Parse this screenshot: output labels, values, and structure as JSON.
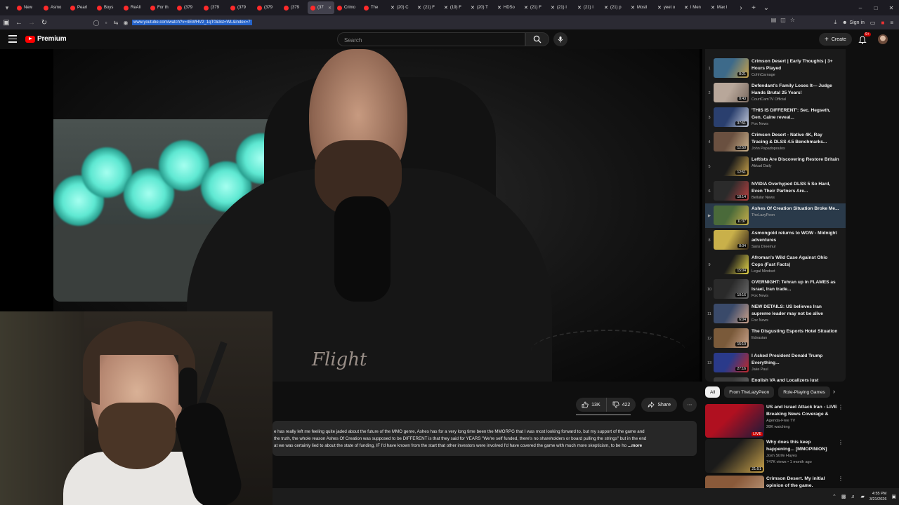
{
  "browser": {
    "tabs": [
      {
        "label": "New",
        "fav": "red"
      },
      {
        "label": "Asmo",
        "fav": "red"
      },
      {
        "label": "Pearl",
        "fav": "red"
      },
      {
        "label": "Boys",
        "fav": "red"
      },
      {
        "label": "ReAll",
        "fav": "red"
      },
      {
        "label": "For th",
        "fav": "red"
      },
      {
        "label": "(379",
        "fav": "red"
      },
      {
        "label": "(379",
        "fav": "red"
      },
      {
        "label": "(379",
        "fav": "red"
      },
      {
        "label": "(379",
        "fav": "red"
      },
      {
        "label": "(379",
        "fav": "red"
      },
      {
        "label": "(37",
        "fav": "red",
        "active": true
      },
      {
        "label": "Crimo",
        "fav": "red"
      },
      {
        "label": "The",
        "fav": "red"
      },
      {
        "label": "(20) C",
        "fav": "x"
      },
      {
        "label": "(21) F",
        "fav": "x"
      },
      {
        "label": "(19) F",
        "fav": "x"
      },
      {
        "label": "(20) T",
        "fav": "x"
      },
      {
        "label": "HDSo",
        "fav": "x"
      },
      {
        "label": "(21) F",
        "fav": "x"
      },
      {
        "label": "(21) I",
        "fav": "x"
      },
      {
        "label": "(21) I",
        "fav": "x"
      },
      {
        "label": "(21) p",
        "fav": "x"
      },
      {
        "label": "Mostl",
        "fav": "x"
      },
      {
        "label": "yeet o",
        "fav": "x"
      },
      {
        "label": "I Men",
        "fav": "x"
      },
      {
        "label": "Max I",
        "fav": "x"
      }
    ],
    "url": "www.youtube.com/watch?v=4EWHV2_1qT0&list=WL&index=7",
    "signin_label": "Sign in"
  },
  "masthead": {
    "brand": "Premium",
    "search_placeholder": "Search",
    "create_label": "Create",
    "notif_badge": "9+"
  },
  "video": {
    "overlay_text": "Flight",
    "likes": "13K",
    "dislikes": "422",
    "share_label": "Share",
    "description": [
      "e has really left me feeling quite jaded about the future of the MMO genre, Ashes has for a very long time been the MMORPG that I was most looking forward to, but my support of the game and",
      " the truth, the whole reason Ashes Of Creation was supposed to be DIFFERENT is that they said for YEARS \"We're self funded, there's no shareholders or board pulling the strings\" but in the end",
      "at we was certainly lied to about the state of funding, IF I'd have known from the start that other investors were involved I'd have covered the game with much more skepticism, to be ho"
    ],
    "description_more": "...more"
  },
  "playlist": [
    {
      "idx": "1",
      "title": "Crimson Desert | Early Thoughts | 3+ Hours Played",
      "channel": "CohhCarnage",
      "duration": "8:21",
      "c1": "#3d6a8a",
      "c2": "#c9a24a"
    },
    {
      "idx": "2",
      "title": "Defendant's Family Loses It— Judge Hands Brutal 25 Years!",
      "channel": "CourtCamTV Official",
      "duration": "8:43",
      "c1": "#b8a79a",
      "c2": "#7a6a60"
    },
    {
      "idx": "3",
      "title": "'THIS IS DIFFERENT': Sec. Hegseth, Gen. Caine reveal...",
      "channel": "Fox News",
      "duration": "37:51",
      "c1": "#2a3f6e",
      "c2": "#c2c8d8"
    },
    {
      "idx": "4",
      "title": "Crimson Desert - Native 4K, Ray Tracing & DLSS 4.5 Benchmarks...",
      "channel": "John Papadopoulos",
      "duration": "12:50",
      "c1": "#6a5040",
      "c2": "#c9b08a"
    },
    {
      "idx": "5",
      "title": "Leftists Are Discovering Restore Britain",
      "channel": "Akkad Daily",
      "duration": "12:51",
      "c1": "#1a1a1a",
      "c2": "#c9a24a"
    },
    {
      "idx": "6",
      "title": "NVIDIA Overhyped DLSS 5 So Hard, Even Their Partners Are...",
      "channel": "Bellular News",
      "duration": "18:14",
      "c1": "#2b2b2b",
      "c2": "#b84040"
    },
    {
      "idx": "▶",
      "title": "Ashes Of Creation Situation Broke Me...",
      "channel": "TheLazyPeon",
      "duration": "11:37",
      "c1": "#4a6a3a",
      "c2": "#c9b04a",
      "current": true
    },
    {
      "idx": "8",
      "title": "Asmongold returns to WOW - Midnight adventures",
      "channel": "Sans Dreemur",
      "duration": "8:04",
      "c1": "#c9b04a",
      "c2": "#3a2a1a"
    },
    {
      "idx": "9",
      "title": "Afroman's Wild Case Against Ohio Cops (Fast Facts)",
      "channel": "Legal Mindset",
      "duration": "15:04",
      "c1": "#1a1a1a",
      "c2": "#e8d84a"
    },
    {
      "idx": "10",
      "title": "OVERNIGHT: Tehran up in FLAMES as Israel, Iran trade...",
      "channel": "Fox News",
      "duration": "10:16",
      "c1": "#2a2a2a",
      "c2": "#6a6a6a"
    },
    {
      "idx": "11",
      "title": "NEW DETAILS: US believes Iran supreme leader may not be alive",
      "channel": "Fox News",
      "duration": "6:04",
      "c1": "#3a4a6a",
      "c2": "#c9a08a"
    },
    {
      "idx": "12",
      "title": "The Disgusting Esports Hotel Situation",
      "channel": "Edvasian",
      "duration": "15:10",
      "c1": "#7a5a3a",
      "c2": "#c9a28a"
    },
    {
      "idx": "13",
      "title": "I Asked President Donald Trump Everything...",
      "channel": "Jake Paul",
      "duration": "27:16",
      "c1": "#2a3a8a",
      "c2": "#c0282a"
    },
    {
      "idx": "14",
      "title": "English VA and Localizers just",
      "channel": "",
      "duration": "",
      "c1": "#3a3a3a",
      "c2": "#6a6a6a"
    }
  ],
  "chips": [
    "All",
    "From TheLazyPeon",
    "Role-Playing Games"
  ],
  "recommendations": [
    {
      "title": "US and Israel Attack Iran - LIVE Breaking News Coverage & Wa...",
      "channel": "Agenda-Free TV",
      "stats": "28K watching",
      "duration": "LIVE",
      "c1": "#b01020",
      "c2": "#1a1a3a"
    },
    {
      "title": "Why does this keep happening... [MMOPINION]",
      "channel": "Josh Strife Hayes",
      "stats": "747K views • 1 month ago",
      "duration": "21:51",
      "c1": "#1a1a1a",
      "c2": "#c9a24a"
    },
    {
      "title": "Crimson Desert. My initial opinion of the game.",
      "channel": "",
      "stats": "",
      "duration": "",
      "c1": "#8a5a3a",
      "c2": "#c9a88a"
    }
  ],
  "taskbar": {
    "time": "4:55 PM",
    "date": "3/21/2026"
  }
}
